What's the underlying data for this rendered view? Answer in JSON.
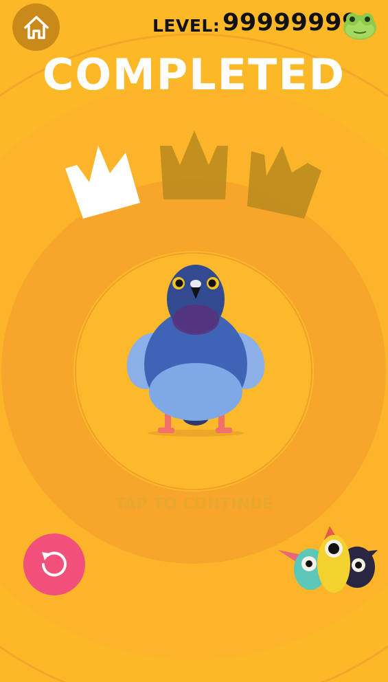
{
  "header": {
    "level_label": "LEVEL:",
    "level_value": "99999999"
  },
  "title": "COMPLETED",
  "crowns": {
    "earned": 1,
    "total": 3,
    "earned_color": "#FFFFFF",
    "unearned_color": "#B8891F"
  },
  "tap_to_continue": "TAP TO CONTINUE",
  "icons": {
    "home": "home-icon",
    "restart": "restart-icon",
    "avatar": "frog-avatar-icon"
  },
  "colors": {
    "background": "#FDB828",
    "ring": "#F7A82A",
    "home_button": "#C98A1A",
    "restart_button": "#F0507A"
  }
}
